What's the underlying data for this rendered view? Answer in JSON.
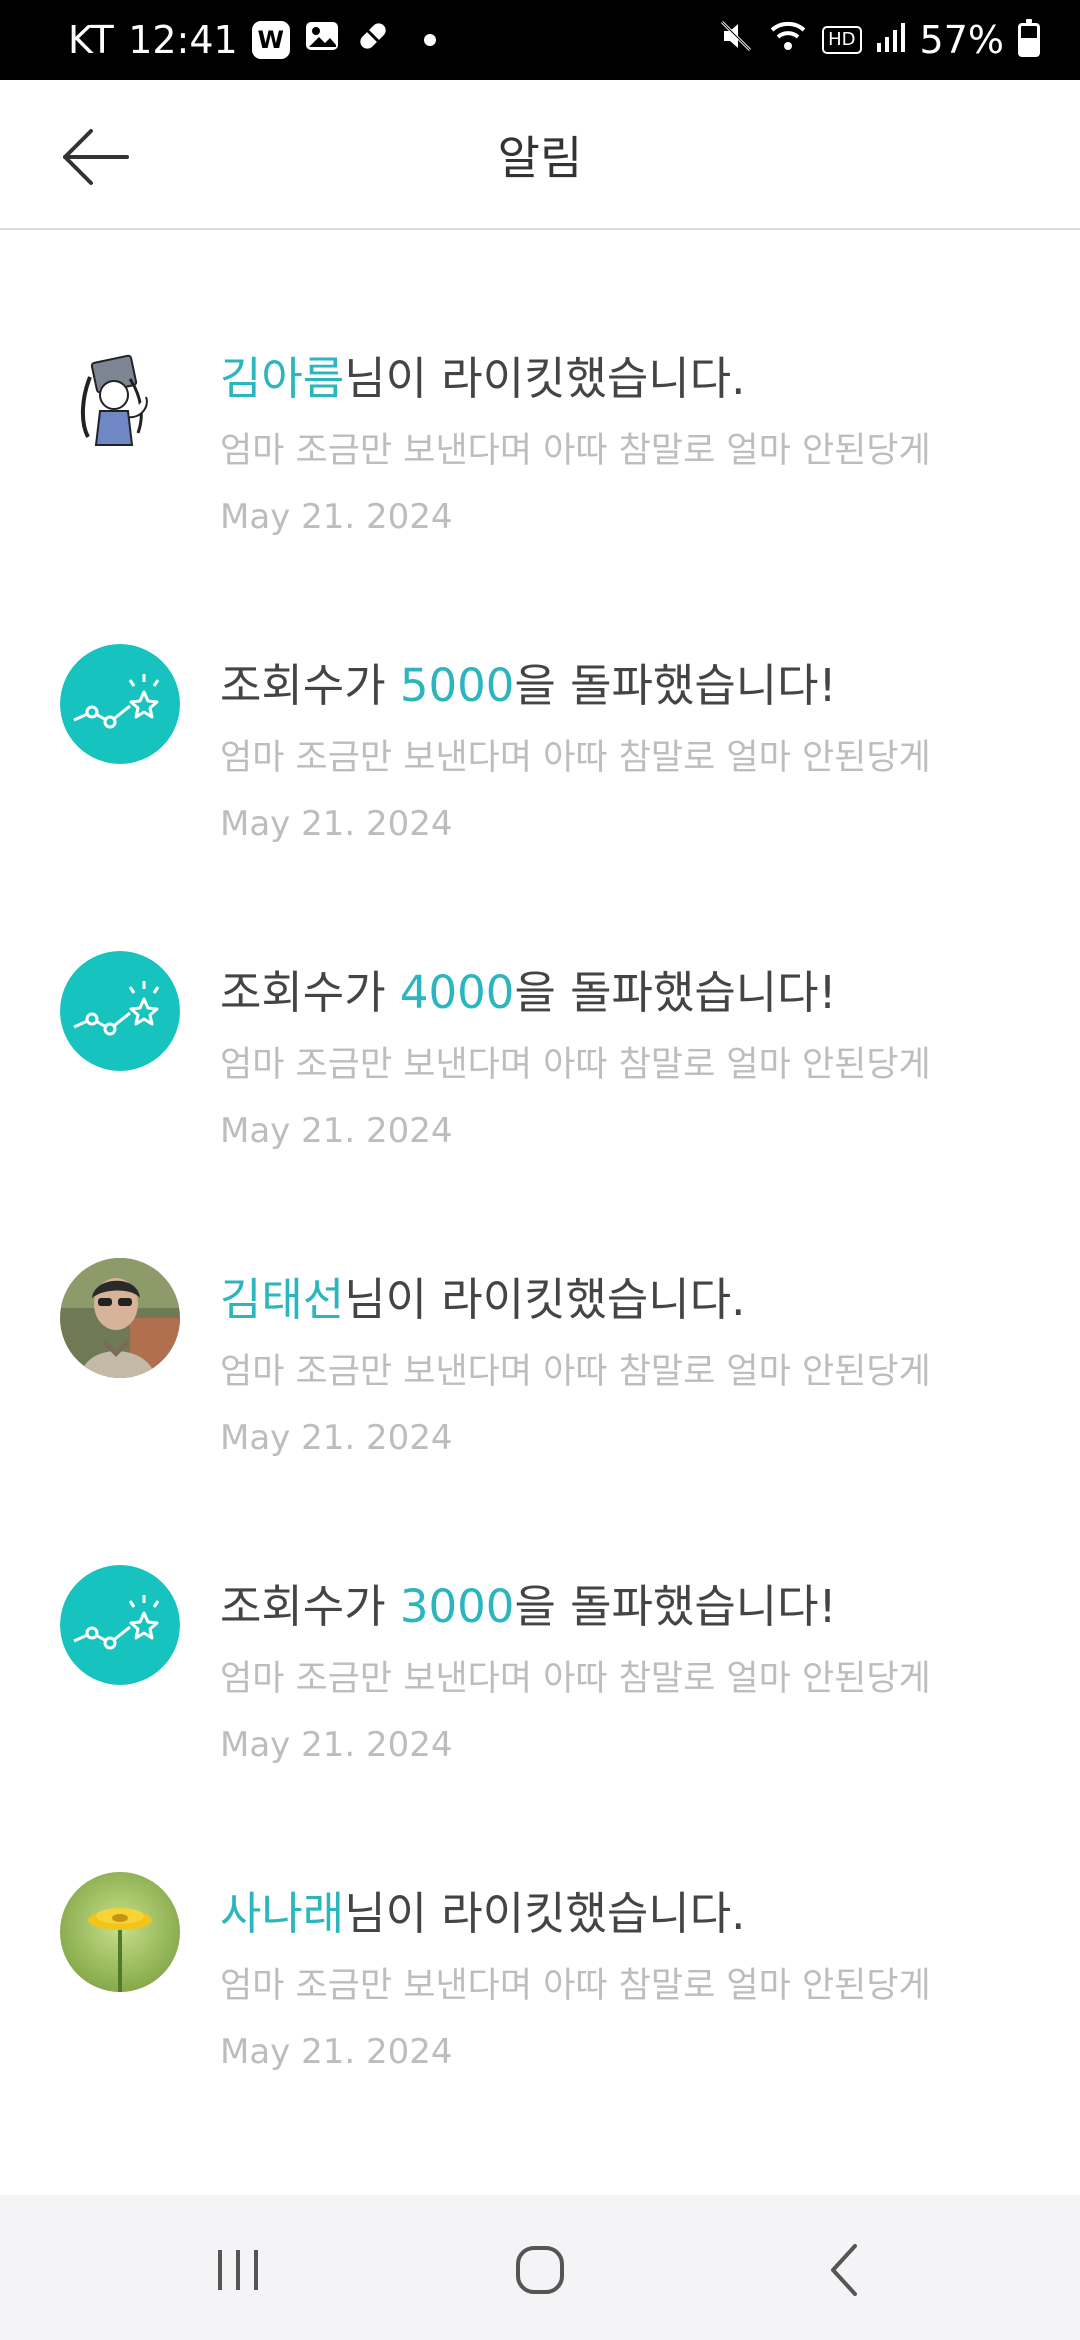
{
  "status_bar": {
    "carrier": "KT",
    "time": "12:41",
    "app_badge": "W",
    "hd_badge": "HD",
    "battery": "57%",
    "battery_level": 0.57
  },
  "header": {
    "title": "알림"
  },
  "notifications": [
    {
      "avatar": "illustrated-girl-avatar",
      "name_highlight": "김아름",
      "title_rest": "님이 라이킷했습니다.",
      "preview": "엄마 조금만 보낸다며 아따 참말로 얼마 안된당게",
      "date": "May 21. 2024"
    },
    {
      "avatar": "view-milestone-icon",
      "title_prefix": "조회수가 ",
      "count_highlight": "5000",
      "title_rest": "을 돌파했습니다!",
      "preview": "엄마 조금만 보낸다며 아따 참말로 얼마 안된당게",
      "date": "May 21. 2024"
    },
    {
      "avatar": "view-milestone-icon",
      "title_prefix": "조회수가 ",
      "count_highlight": "4000",
      "title_rest": "을 돌파했습니다!",
      "preview": "엄마 조금만 보낸다며 아따 참말로 얼마 안된당게",
      "date": "May 21. 2024"
    },
    {
      "avatar": "user-photo-avatar",
      "name_highlight": "김태선",
      "title_rest": "님이 라이킷했습니다.",
      "preview": "엄마 조금만 보낸다며 아따 참말로 얼마 안된당게",
      "date": "May 21. 2024"
    },
    {
      "avatar": "view-milestone-icon",
      "title_prefix": "조회수가 ",
      "count_highlight": "3000",
      "title_rest": "을 돌파했습니다!",
      "preview": "엄마 조금만 보낸다며 아따 참말로 얼마 안된당게",
      "date": "May 21. 2024"
    },
    {
      "avatar": "flower-photo-avatar",
      "name_highlight": "사나래",
      "title_rest": "님이 라이킷했습니다.",
      "preview": "엄마 조금만 보낸다며 아따 참말로 얼마 안된당게",
      "date": "May 21. 2024"
    }
  ],
  "colors": {
    "accent": "#2bb5be",
    "milestone_icon_bg": "#17c3be",
    "title_text": "#444444",
    "secondary_text": "#bdbdbd"
  }
}
